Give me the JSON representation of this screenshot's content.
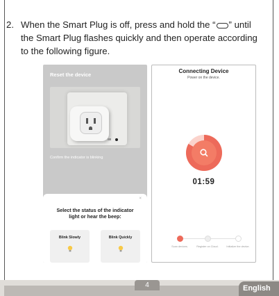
{
  "instruction": {
    "number": "2.",
    "line1_a": "When the Smart Plug is off, press and hold the “",
    "line1_b": "” until",
    "line2": "the Smart Plug flashes quickly and then operate according",
    "line3": "to the following figure."
  },
  "screen_reset": {
    "title": "Reset the device",
    "confirm_text": "Confirm the indicator is blinking",
    "sheet_close": "×",
    "prompt": "Select the status of the indicator light or hear the beep:",
    "options": [
      {
        "label": "Blink Slowly",
        "icon": "bulb-icon"
      },
      {
        "label": "Blink Quickly",
        "icon": "bulb-icon"
      }
    ]
  },
  "screen_connecting": {
    "title": "Connecting Device",
    "subtitle": "Power on the device.",
    "timer": "01:59",
    "steps": [
      {
        "label": "Scan devices.",
        "state": "active"
      },
      {
        "label": "Register on Cloud.",
        "state": "pending"
      },
      {
        "label": "Initialize the device.",
        "state": "pending"
      }
    ]
  },
  "footer": {
    "page_number": "4",
    "language": "English"
  },
  "colors": {
    "accent": "#ed6a5a",
    "accent_light": "#fbd3cc",
    "bulb": "#f7c948",
    "footer_bar": "#bdb9b5"
  }
}
